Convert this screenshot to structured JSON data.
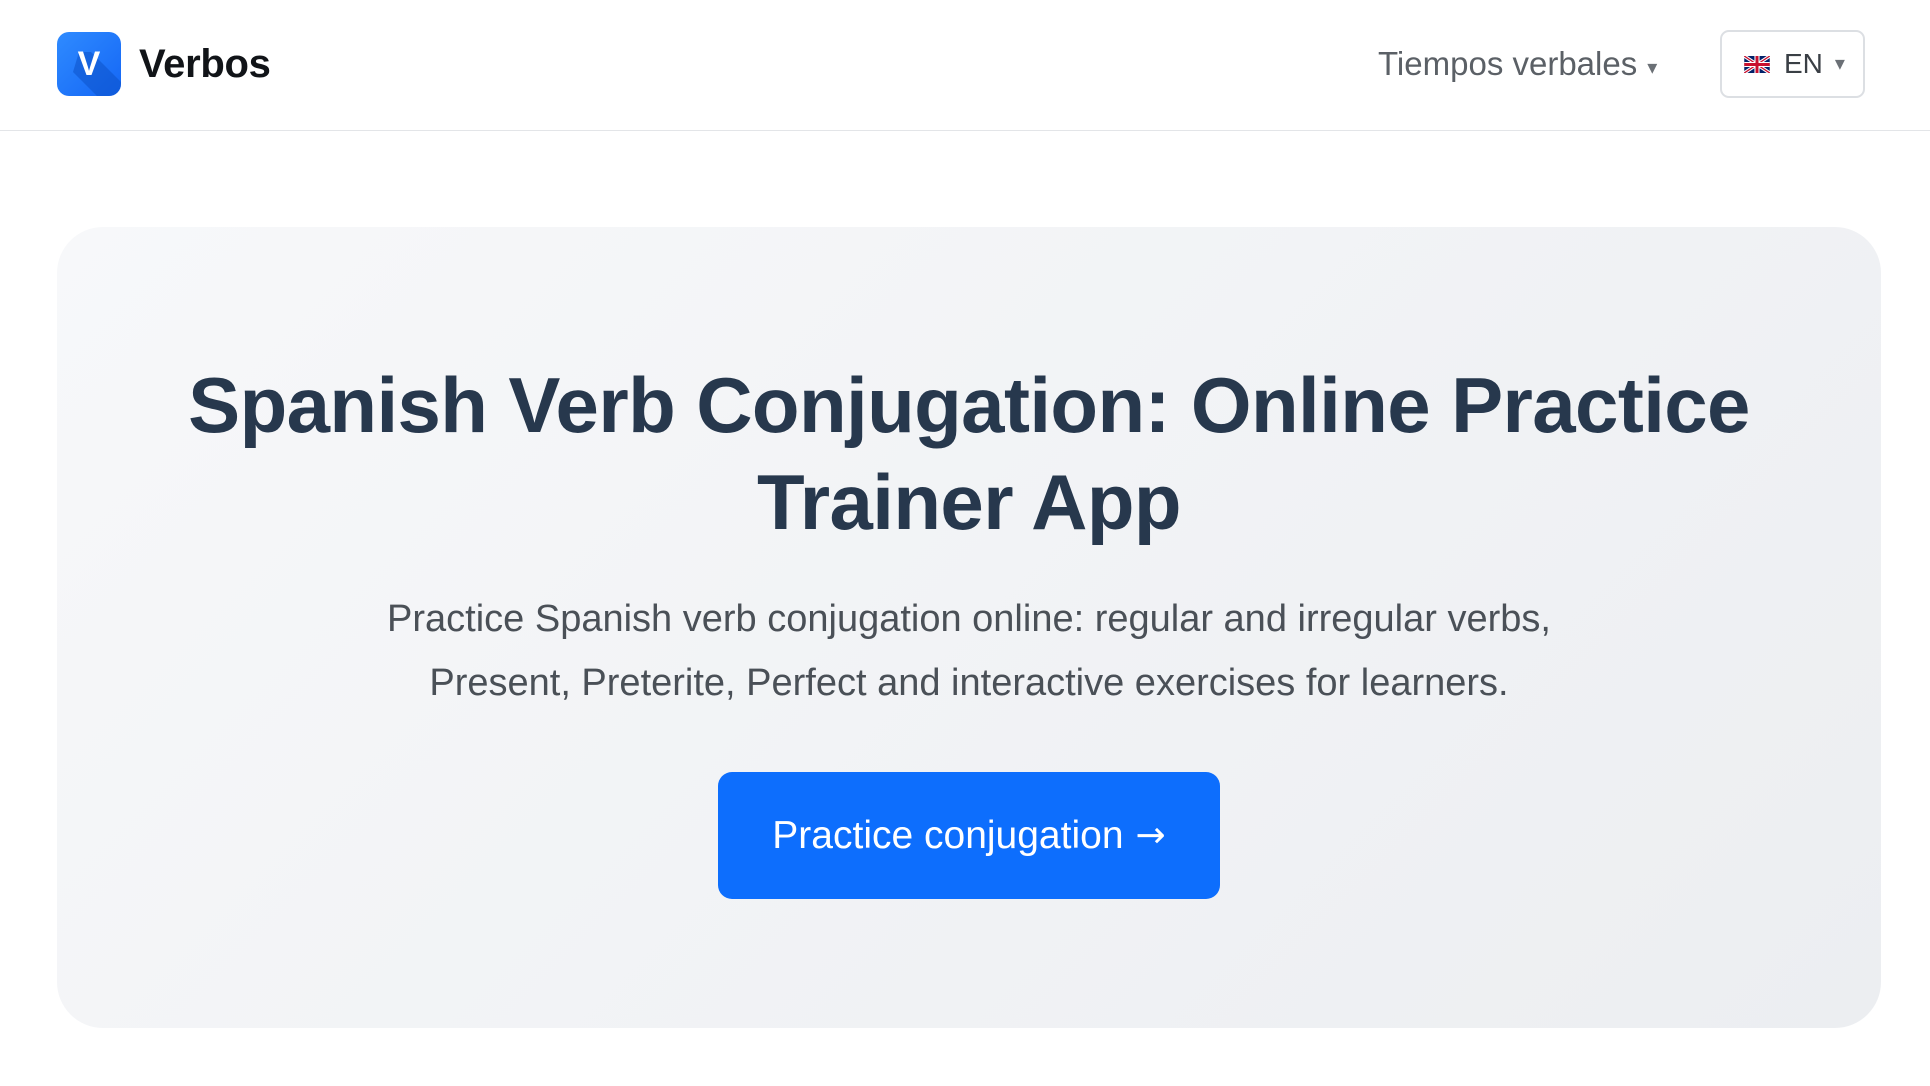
{
  "header": {
    "brand_initial": "V",
    "brand_name": "Verbos",
    "nav_dropdown_label": "Tiempos verbales",
    "nav_dropdown_caret": "▾",
    "language": {
      "code": "EN",
      "flag_icon": "uk-flag-icon",
      "caret": "▾"
    }
  },
  "hero": {
    "title": "Spanish Verb Conjugation: Online Practice Trainer App",
    "subtitle": "Practice Spanish verb conjugation online: regular and irregular verbs, Present, Preterite, Perfect and interactive exercises for learners.",
    "cta_label": "Practice conjugation",
    "cta_arrow": "→"
  },
  "colors": {
    "accent": "#0d6efd",
    "logo": "#1e7bff",
    "title": "#27384d",
    "hero_background": "#f1f2f4"
  }
}
